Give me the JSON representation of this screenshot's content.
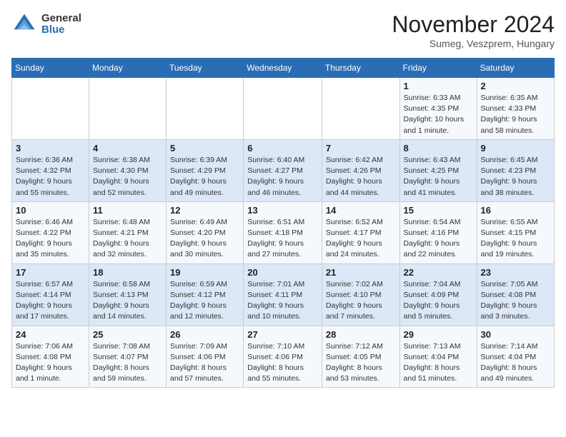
{
  "header": {
    "logo_general": "General",
    "logo_blue": "Blue",
    "month_title": "November 2024",
    "location": "Sumeg, Veszprem, Hungary"
  },
  "days_of_week": [
    "Sunday",
    "Monday",
    "Tuesday",
    "Wednesday",
    "Thursday",
    "Friday",
    "Saturday"
  ],
  "weeks": [
    [
      {
        "day": "",
        "info": ""
      },
      {
        "day": "",
        "info": ""
      },
      {
        "day": "",
        "info": ""
      },
      {
        "day": "",
        "info": ""
      },
      {
        "day": "",
        "info": ""
      },
      {
        "day": "1",
        "info": "Sunrise: 6:33 AM\nSunset: 4:35 PM\nDaylight: 10 hours\nand 1 minute."
      },
      {
        "day": "2",
        "info": "Sunrise: 6:35 AM\nSunset: 4:33 PM\nDaylight: 9 hours\nand 58 minutes."
      }
    ],
    [
      {
        "day": "3",
        "info": "Sunrise: 6:36 AM\nSunset: 4:32 PM\nDaylight: 9 hours\nand 55 minutes."
      },
      {
        "day": "4",
        "info": "Sunrise: 6:38 AM\nSunset: 4:30 PM\nDaylight: 9 hours\nand 52 minutes."
      },
      {
        "day": "5",
        "info": "Sunrise: 6:39 AM\nSunset: 4:29 PM\nDaylight: 9 hours\nand 49 minutes."
      },
      {
        "day": "6",
        "info": "Sunrise: 6:40 AM\nSunset: 4:27 PM\nDaylight: 9 hours\nand 46 minutes."
      },
      {
        "day": "7",
        "info": "Sunrise: 6:42 AM\nSunset: 4:26 PM\nDaylight: 9 hours\nand 44 minutes."
      },
      {
        "day": "8",
        "info": "Sunrise: 6:43 AM\nSunset: 4:25 PM\nDaylight: 9 hours\nand 41 minutes."
      },
      {
        "day": "9",
        "info": "Sunrise: 6:45 AM\nSunset: 4:23 PM\nDaylight: 9 hours\nand 38 minutes."
      }
    ],
    [
      {
        "day": "10",
        "info": "Sunrise: 6:46 AM\nSunset: 4:22 PM\nDaylight: 9 hours\nand 35 minutes."
      },
      {
        "day": "11",
        "info": "Sunrise: 6:48 AM\nSunset: 4:21 PM\nDaylight: 9 hours\nand 32 minutes."
      },
      {
        "day": "12",
        "info": "Sunrise: 6:49 AM\nSunset: 4:20 PM\nDaylight: 9 hours\nand 30 minutes."
      },
      {
        "day": "13",
        "info": "Sunrise: 6:51 AM\nSunset: 4:18 PM\nDaylight: 9 hours\nand 27 minutes."
      },
      {
        "day": "14",
        "info": "Sunrise: 6:52 AM\nSunset: 4:17 PM\nDaylight: 9 hours\nand 24 minutes."
      },
      {
        "day": "15",
        "info": "Sunrise: 6:54 AM\nSunset: 4:16 PM\nDaylight: 9 hours\nand 22 minutes."
      },
      {
        "day": "16",
        "info": "Sunrise: 6:55 AM\nSunset: 4:15 PM\nDaylight: 9 hours\nand 19 minutes."
      }
    ],
    [
      {
        "day": "17",
        "info": "Sunrise: 6:57 AM\nSunset: 4:14 PM\nDaylight: 9 hours\nand 17 minutes."
      },
      {
        "day": "18",
        "info": "Sunrise: 6:58 AM\nSunset: 4:13 PM\nDaylight: 9 hours\nand 14 minutes."
      },
      {
        "day": "19",
        "info": "Sunrise: 6:59 AM\nSunset: 4:12 PM\nDaylight: 9 hours\nand 12 minutes."
      },
      {
        "day": "20",
        "info": "Sunrise: 7:01 AM\nSunset: 4:11 PM\nDaylight: 9 hours\nand 10 minutes."
      },
      {
        "day": "21",
        "info": "Sunrise: 7:02 AM\nSunset: 4:10 PM\nDaylight: 9 hours\nand 7 minutes."
      },
      {
        "day": "22",
        "info": "Sunrise: 7:04 AM\nSunset: 4:09 PM\nDaylight: 9 hours\nand 5 minutes."
      },
      {
        "day": "23",
        "info": "Sunrise: 7:05 AM\nSunset: 4:08 PM\nDaylight: 9 hours\nand 3 minutes."
      }
    ],
    [
      {
        "day": "24",
        "info": "Sunrise: 7:06 AM\nSunset: 4:08 PM\nDaylight: 9 hours\nand 1 minute."
      },
      {
        "day": "25",
        "info": "Sunrise: 7:08 AM\nSunset: 4:07 PM\nDaylight: 8 hours\nand 59 minutes."
      },
      {
        "day": "26",
        "info": "Sunrise: 7:09 AM\nSunset: 4:06 PM\nDaylight: 8 hours\nand 57 minutes."
      },
      {
        "day": "27",
        "info": "Sunrise: 7:10 AM\nSunset: 4:06 PM\nDaylight: 8 hours\nand 55 minutes."
      },
      {
        "day": "28",
        "info": "Sunrise: 7:12 AM\nSunset: 4:05 PM\nDaylight: 8 hours\nand 53 minutes."
      },
      {
        "day": "29",
        "info": "Sunrise: 7:13 AM\nSunset: 4:04 PM\nDaylight: 8 hours\nand 51 minutes."
      },
      {
        "day": "30",
        "info": "Sunrise: 7:14 AM\nSunset: 4:04 PM\nDaylight: 8 hours\nand 49 minutes."
      }
    ]
  ]
}
